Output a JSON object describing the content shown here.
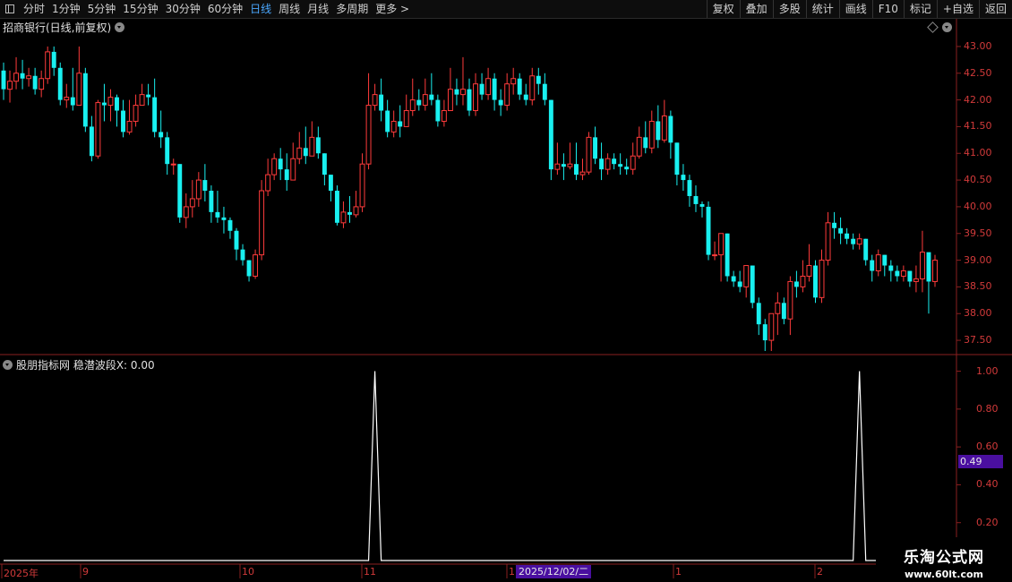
{
  "toolbar": {
    "period_items": [
      "分时",
      "1分钟",
      "5分钟",
      "15分钟",
      "30分钟",
      "60分钟",
      "日线",
      "周线",
      "月线",
      "多周期",
      "更多 >"
    ],
    "active_item": "日线",
    "right_items": [
      "复权",
      "叠加",
      "多股",
      "统计",
      "画线",
      "F10",
      "标记",
      "+自选",
      "返回"
    ]
  },
  "main_chart": {
    "title": "招商银行(日线,前复权)",
    "y_ticks": [
      "43.00",
      "42.50",
      "42.00",
      "41.50",
      "41.00",
      "40.50",
      "40.00",
      "39.50",
      "39.00",
      "38.50",
      "38.00",
      "37.50"
    ]
  },
  "sub_chart": {
    "title": "股朋指标网  稳潜波段X: 0.00",
    "y_ticks": [
      "1.00",
      "0.80",
      "0.60",
      "0.40",
      "0.20"
    ],
    "cursor_value": "0.49"
  },
  "date_axis": {
    "labels": [
      "2025年",
      "9",
      "10",
      "11",
      "1",
      "1",
      "2"
    ],
    "highlight": "2025/12/02/二"
  },
  "watermark": {
    "title": "乐淘公式网",
    "url": "www.60lt.com"
  },
  "chart_data": {
    "type": "candlestick",
    "ylim": [
      37.3,
      43.2
    ],
    "up_color": "#ff3b3b",
    "down_color": "#19f0f0",
    "candles": [
      [
        42.55,
        42.2,
        42.7,
        42.0
      ],
      [
        42.2,
        42.35,
        42.55,
        41.95
      ],
      [
        42.35,
        42.5,
        42.8,
        42.2
      ],
      [
        42.5,
        42.4,
        42.75,
        42.2
      ],
      [
        42.4,
        42.45,
        42.6,
        42.25
      ],
      [
        42.45,
        42.2,
        42.6,
        42.1
      ],
      [
        42.2,
        42.4,
        42.55,
        42.05
      ],
      [
        42.4,
        42.9,
        43.0,
        42.3
      ],
      [
        42.9,
        42.6,
        43.0,
        42.45
      ],
      [
        42.6,
        42.0,
        42.7,
        41.9
      ],
      [
        42.0,
        42.05,
        42.3,
        41.85
      ],
      [
        42.05,
        41.9,
        42.6,
        41.8
      ],
      [
        41.9,
        42.5,
        43.0,
        41.9
      ],
      [
        42.5,
        41.5,
        42.6,
        41.4
      ],
      [
        41.5,
        40.95,
        41.7,
        40.85
      ],
      [
        40.95,
        41.95,
        42.0,
        40.9
      ],
      [
        41.95,
        41.9,
        42.3,
        41.6
      ],
      [
        41.9,
        42.05,
        42.2,
        41.6
      ],
      [
        42.05,
        41.8,
        42.1,
        41.5
      ],
      [
        41.8,
        41.4,
        42.0,
        41.3
      ],
      [
        41.4,
        41.6,
        42.0,
        41.35
      ],
      [
        41.6,
        41.9,
        42.1,
        41.5
      ],
      [
        41.9,
        42.1,
        42.3,
        41.9
      ],
      [
        42.1,
        42.05,
        42.3,
        41.9
      ],
      [
        42.05,
        41.4,
        42.4,
        41.3
      ],
      [
        41.4,
        41.3,
        41.8,
        41.1
      ],
      [
        41.3,
        40.8,
        41.4,
        40.6
      ],
      [
        40.8,
        40.8,
        40.9,
        40.6
      ],
      [
        40.8,
        39.8,
        40.8,
        39.7
      ],
      [
        39.8,
        40.0,
        40.25,
        39.6
      ],
      [
        40.0,
        40.15,
        40.5,
        39.8
      ],
      [
        40.15,
        40.5,
        40.65,
        40.0
      ],
      [
        40.5,
        40.3,
        40.8,
        40.1
      ],
      [
        40.3,
        39.9,
        40.4,
        39.7
      ],
      [
        39.9,
        39.8,
        40.3,
        39.7
      ],
      [
        39.8,
        39.75,
        40.0,
        39.5
      ],
      [
        39.75,
        39.55,
        39.8,
        39.4
      ],
      [
        39.55,
        39.2,
        39.6,
        39.0
      ],
      [
        39.2,
        39.0,
        39.3,
        38.9
      ],
      [
        39.0,
        38.7,
        39.0,
        38.6
      ],
      [
        38.7,
        39.1,
        39.2,
        38.65
      ],
      [
        39.1,
        40.3,
        40.5,
        39.0
      ],
      [
        40.3,
        40.6,
        40.9,
        40.2
      ],
      [
        40.6,
        40.9,
        41.0,
        40.5
      ],
      [
        40.9,
        40.7,
        41.1,
        40.5
      ],
      [
        40.7,
        40.5,
        41.0,
        40.3
      ],
      [
        40.5,
        40.9,
        41.2,
        40.5
      ],
      [
        40.9,
        41.1,
        41.4,
        40.8
      ],
      [
        41.1,
        40.95,
        41.5,
        40.8
      ],
      [
        40.95,
        41.3,
        41.6,
        41.0
      ],
      [
        41.3,
        41.0,
        41.5,
        40.9
      ],
      [
        41.0,
        40.6,
        41.0,
        40.4
      ],
      [
        40.6,
        40.3,
        40.6,
        40.1
      ],
      [
        40.3,
        39.7,
        40.4,
        39.65
      ],
      [
        39.7,
        39.9,
        40.1,
        39.6
      ],
      [
        39.9,
        39.85,
        40.2,
        39.7
      ],
      [
        39.85,
        40.0,
        40.3,
        39.8
      ],
      [
        40.0,
        40.8,
        41.0,
        39.9
      ],
      [
        40.8,
        41.9,
        42.5,
        40.7
      ],
      [
        41.9,
        42.1,
        42.3,
        41.8
      ],
      [
        42.1,
        41.8,
        42.4,
        41.6
      ],
      [
        41.8,
        41.4,
        42.0,
        41.3
      ],
      [
        41.4,
        41.6,
        41.8,
        41.3
      ],
      [
        41.6,
        41.5,
        41.9,
        41.3
      ],
      [
        41.5,
        41.8,
        42.1,
        41.5
      ],
      [
        41.8,
        42.0,
        42.4,
        41.7
      ],
      [
        42.0,
        41.9,
        42.2,
        41.8
      ],
      [
        41.9,
        42.1,
        42.4,
        41.8
      ],
      [
        42.1,
        42.0,
        42.5,
        41.9
      ],
      [
        42.0,
        41.6,
        42.1,
        41.5
      ],
      [
        41.6,
        41.8,
        42.0,
        41.5
      ],
      [
        41.8,
        42.2,
        42.6,
        41.8
      ],
      [
        42.2,
        42.1,
        42.4,
        41.9
      ],
      [
        42.1,
        42.2,
        42.8,
        41.9
      ],
      [
        42.2,
        41.8,
        42.4,
        41.7
      ],
      [
        41.8,
        42.3,
        42.5,
        41.7
      ],
      [
        42.3,
        42.1,
        42.5,
        42.0
      ],
      [
        42.1,
        42.4,
        42.6,
        42.0
      ],
      [
        42.4,
        42.0,
        42.5,
        41.8
      ],
      [
        42.0,
        41.9,
        42.2,
        41.7
      ],
      [
        41.9,
        42.3,
        42.5,
        41.8
      ],
      [
        42.3,
        42.4,
        42.6,
        42.1
      ],
      [
        42.4,
        42.1,
        42.5,
        42.0
      ],
      [
        42.1,
        42.0,
        42.3,
        41.9
      ],
      [
        42.0,
        42.45,
        42.6,
        41.9
      ],
      [
        42.45,
        42.3,
        42.6,
        42.1
      ],
      [
        42.3,
        42.0,
        42.5,
        41.9
      ],
      [
        42.0,
        40.7,
        42.0,
        40.5
      ],
      [
        40.7,
        40.8,
        41.2,
        40.6
      ],
      [
        40.8,
        40.75,
        41.0,
        40.5
      ],
      [
        40.75,
        40.8,
        41.2,
        40.7
      ],
      [
        40.8,
        40.6,
        41.2,
        40.5
      ],
      [
        40.6,
        40.65,
        40.9,
        40.5
      ],
      [
        40.65,
        41.3,
        41.4,
        40.6
      ],
      [
        41.3,
        40.9,
        41.5,
        40.8
      ],
      [
        40.9,
        40.7,
        41.2,
        40.5
      ],
      [
        40.7,
        40.9,
        41.0,
        40.6
      ],
      [
        40.9,
        40.8,
        41.0,
        40.7
      ],
      [
        40.8,
        40.75,
        41.0,
        40.6
      ],
      [
        40.75,
        40.7,
        40.9,
        40.6
      ],
      [
        40.7,
        40.95,
        41.2,
        40.6
      ],
      [
        40.95,
        41.3,
        41.5,
        40.9
      ],
      [
        41.3,
        41.1,
        41.6,
        41.0
      ],
      [
        41.1,
        41.6,
        41.8,
        41.0
      ],
      [
        41.6,
        41.25,
        41.9,
        41.1
      ],
      [
        41.25,
        41.7,
        42.0,
        41.2
      ],
      [
        41.7,
        41.2,
        41.8,
        40.9
      ],
      [
        41.2,
        40.6,
        41.2,
        40.4
      ],
      [
        40.6,
        40.5,
        40.8,
        40.3
      ],
      [
        40.5,
        40.2,
        40.6,
        40.0
      ],
      [
        40.2,
        40.05,
        40.4,
        39.9
      ],
      [
        40.05,
        40.0,
        40.1,
        39.8
      ],
      [
        40.0,
        39.1,
        40.1,
        39.0
      ],
      [
        39.1,
        39.1,
        39.35,
        39.0
      ],
      [
        39.1,
        39.5,
        39.5,
        38.6
      ],
      [
        39.5,
        38.7,
        39.5,
        38.6
      ],
      [
        38.7,
        38.6,
        38.8,
        38.5
      ],
      [
        38.6,
        38.5,
        38.8,
        38.4
      ],
      [
        38.5,
        38.9,
        38.9,
        38.3
      ],
      [
        38.9,
        38.2,
        38.9,
        38.1
      ],
      [
        38.2,
        37.8,
        38.3,
        37.6
      ],
      [
        37.8,
        37.5,
        37.9,
        37.3
      ],
      [
        37.5,
        38.0,
        38.0,
        37.3
      ],
      [
        38.0,
        38.2,
        38.4,
        37.6
      ],
      [
        38.2,
        37.9,
        38.3,
        37.8
      ],
      [
        37.9,
        38.6,
        38.7,
        37.6
      ],
      [
        38.6,
        38.5,
        38.8,
        38.3
      ],
      [
        38.5,
        38.7,
        39.0,
        38.4
      ],
      [
        38.7,
        38.9,
        39.3,
        38.6
      ],
      [
        38.9,
        38.3,
        39.0,
        38.2
      ],
      [
        38.3,
        39.0,
        39.2,
        38.2
      ],
      [
        39.0,
        39.7,
        39.9,
        38.9
      ],
      [
        39.7,
        39.6,
        39.9,
        39.4
      ],
      [
        39.6,
        39.5,
        39.8,
        39.3
      ],
      [
        39.5,
        39.4,
        39.6,
        39.3
      ],
      [
        39.4,
        39.3,
        39.5,
        39.2
      ],
      [
        39.3,
        39.4,
        39.5,
        39.2
      ],
      [
        39.4,
        39.0,
        39.4,
        38.9
      ],
      [
        39.0,
        38.8,
        39.1,
        38.6
      ],
      [
        38.8,
        39.1,
        39.2,
        38.7
      ],
      [
        39.1,
        38.9,
        39.1,
        38.7
      ],
      [
        38.9,
        38.8,
        39.0,
        38.6
      ],
      [
        38.8,
        38.7,
        38.9,
        38.6
      ],
      [
        38.7,
        38.8,
        38.9,
        38.6
      ],
      [
        38.8,
        38.6,
        38.8,
        38.5
      ],
      [
        38.6,
        38.65,
        38.9,
        38.4
      ],
      [
        38.65,
        39.15,
        39.55,
        38.4
      ],
      [
        39.15,
        38.6,
        39.0,
        38.0
      ],
      [
        38.6,
        39.0,
        39.1,
        38.5
      ]
    ],
    "sub_series_ylim": [
      0,
      1.05
    ],
    "sub_series_spikes": [
      {
        "index": 59,
        "value": 1.0
      },
      {
        "index": 136,
        "value": 1.0
      }
    ]
  }
}
